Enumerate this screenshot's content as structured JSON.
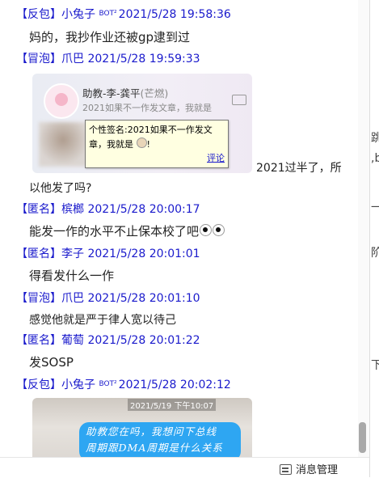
{
  "messages": [
    {
      "role": "【反包】",
      "nick": "小兔子",
      "bot": "BOT²",
      "time": "2021/5/28 19:58:36",
      "text": "妈的，我抄作业还被gp逮到过"
    },
    {
      "role": "【冒泡】",
      "nick": "爪巴",
      "time": "2021/5/28 19:59:33"
    },
    {
      "role": "【匿名】",
      "nick": "槟榔",
      "time": "2021/5/28 20:00:17",
      "text": "能发一作的水平不止保本校了吧"
    },
    {
      "role": "【匿名】",
      "nick": "李子",
      "time": "2021/5/28 20:01:01",
      "text": "得看发什么一作"
    },
    {
      "role": "【冒泡】",
      "nick": "爪巴",
      "time": "2021/5/28 20:01:10",
      "text": "感觉他就是严于律人宽以待己"
    },
    {
      "role": "【匿名】",
      "nick": "葡萄",
      "time": "2021/5/28 20:01:22",
      "text": "发SOSP"
    },
    {
      "role": "【反包】",
      "nick": "小兔子",
      "bot": "BOT²",
      "time": "2021/5/28 20:02:12"
    }
  ],
  "card": {
    "name": "助教-李-龚平",
    "tag": "(芒燃)",
    "signature": "2021如果不一作发文章，我就是",
    "after_text_1": "2021过半了，所",
    "after_text_2": "以他发了吗?"
  },
  "tooltip": {
    "text": "个性签名:2021如果不一作发文章，我就是",
    "tail": "!",
    "link": "评论"
  },
  "image": {
    "timestamp": "2021/5/19 下午10:07",
    "bubble_line1": "助教您在吗，我想问下总线",
    "bubble_line2": "周期跟DMA周期是什么关系"
  },
  "footer": {
    "manage_label": "消息管理"
  },
  "right_edge": [
    "跳",
    ",bu",
    "一务",
    "阶",
    "下同"
  ]
}
